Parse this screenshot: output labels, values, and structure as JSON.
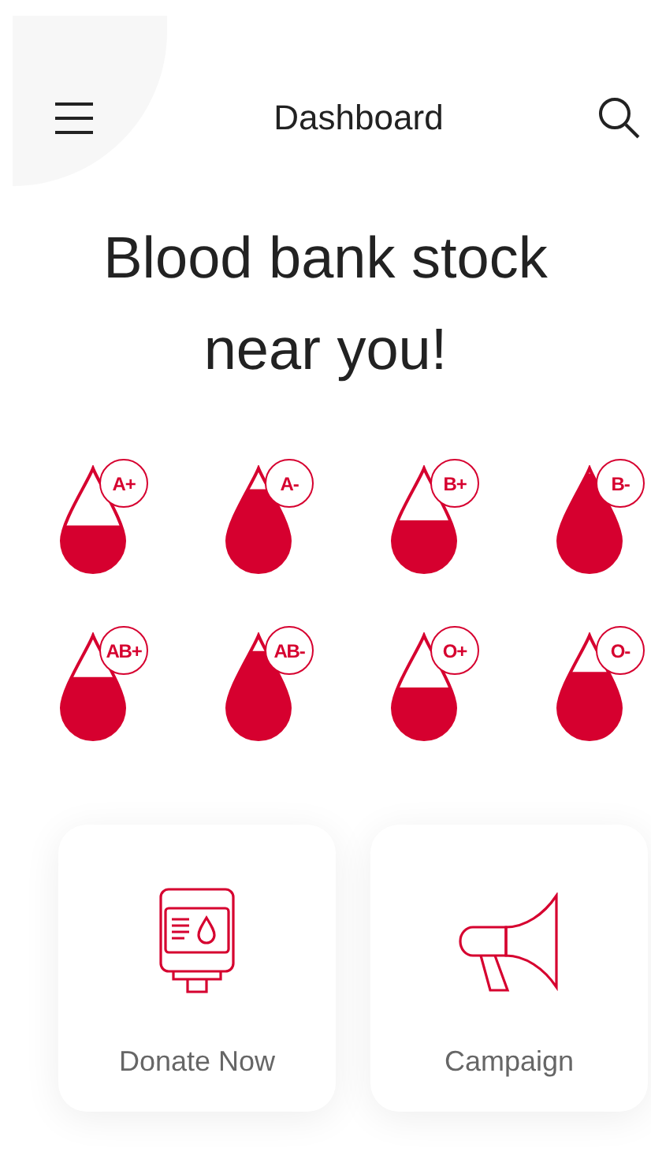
{
  "header": {
    "title": "Dashboard"
  },
  "heading": "Blood bank stock near you!",
  "blood_groups": [
    {
      "label": "A+"
    },
    {
      "label": "A-"
    },
    {
      "label": "B+"
    },
    {
      "label": "B-"
    },
    {
      "label": "AB+"
    },
    {
      "label": "AB-"
    },
    {
      "label": "O+"
    },
    {
      "label": "O-"
    }
  ],
  "actions": [
    {
      "kind": "donate",
      "label": "Donate Now"
    },
    {
      "kind": "campaign",
      "label": "Campaign"
    }
  ]
}
